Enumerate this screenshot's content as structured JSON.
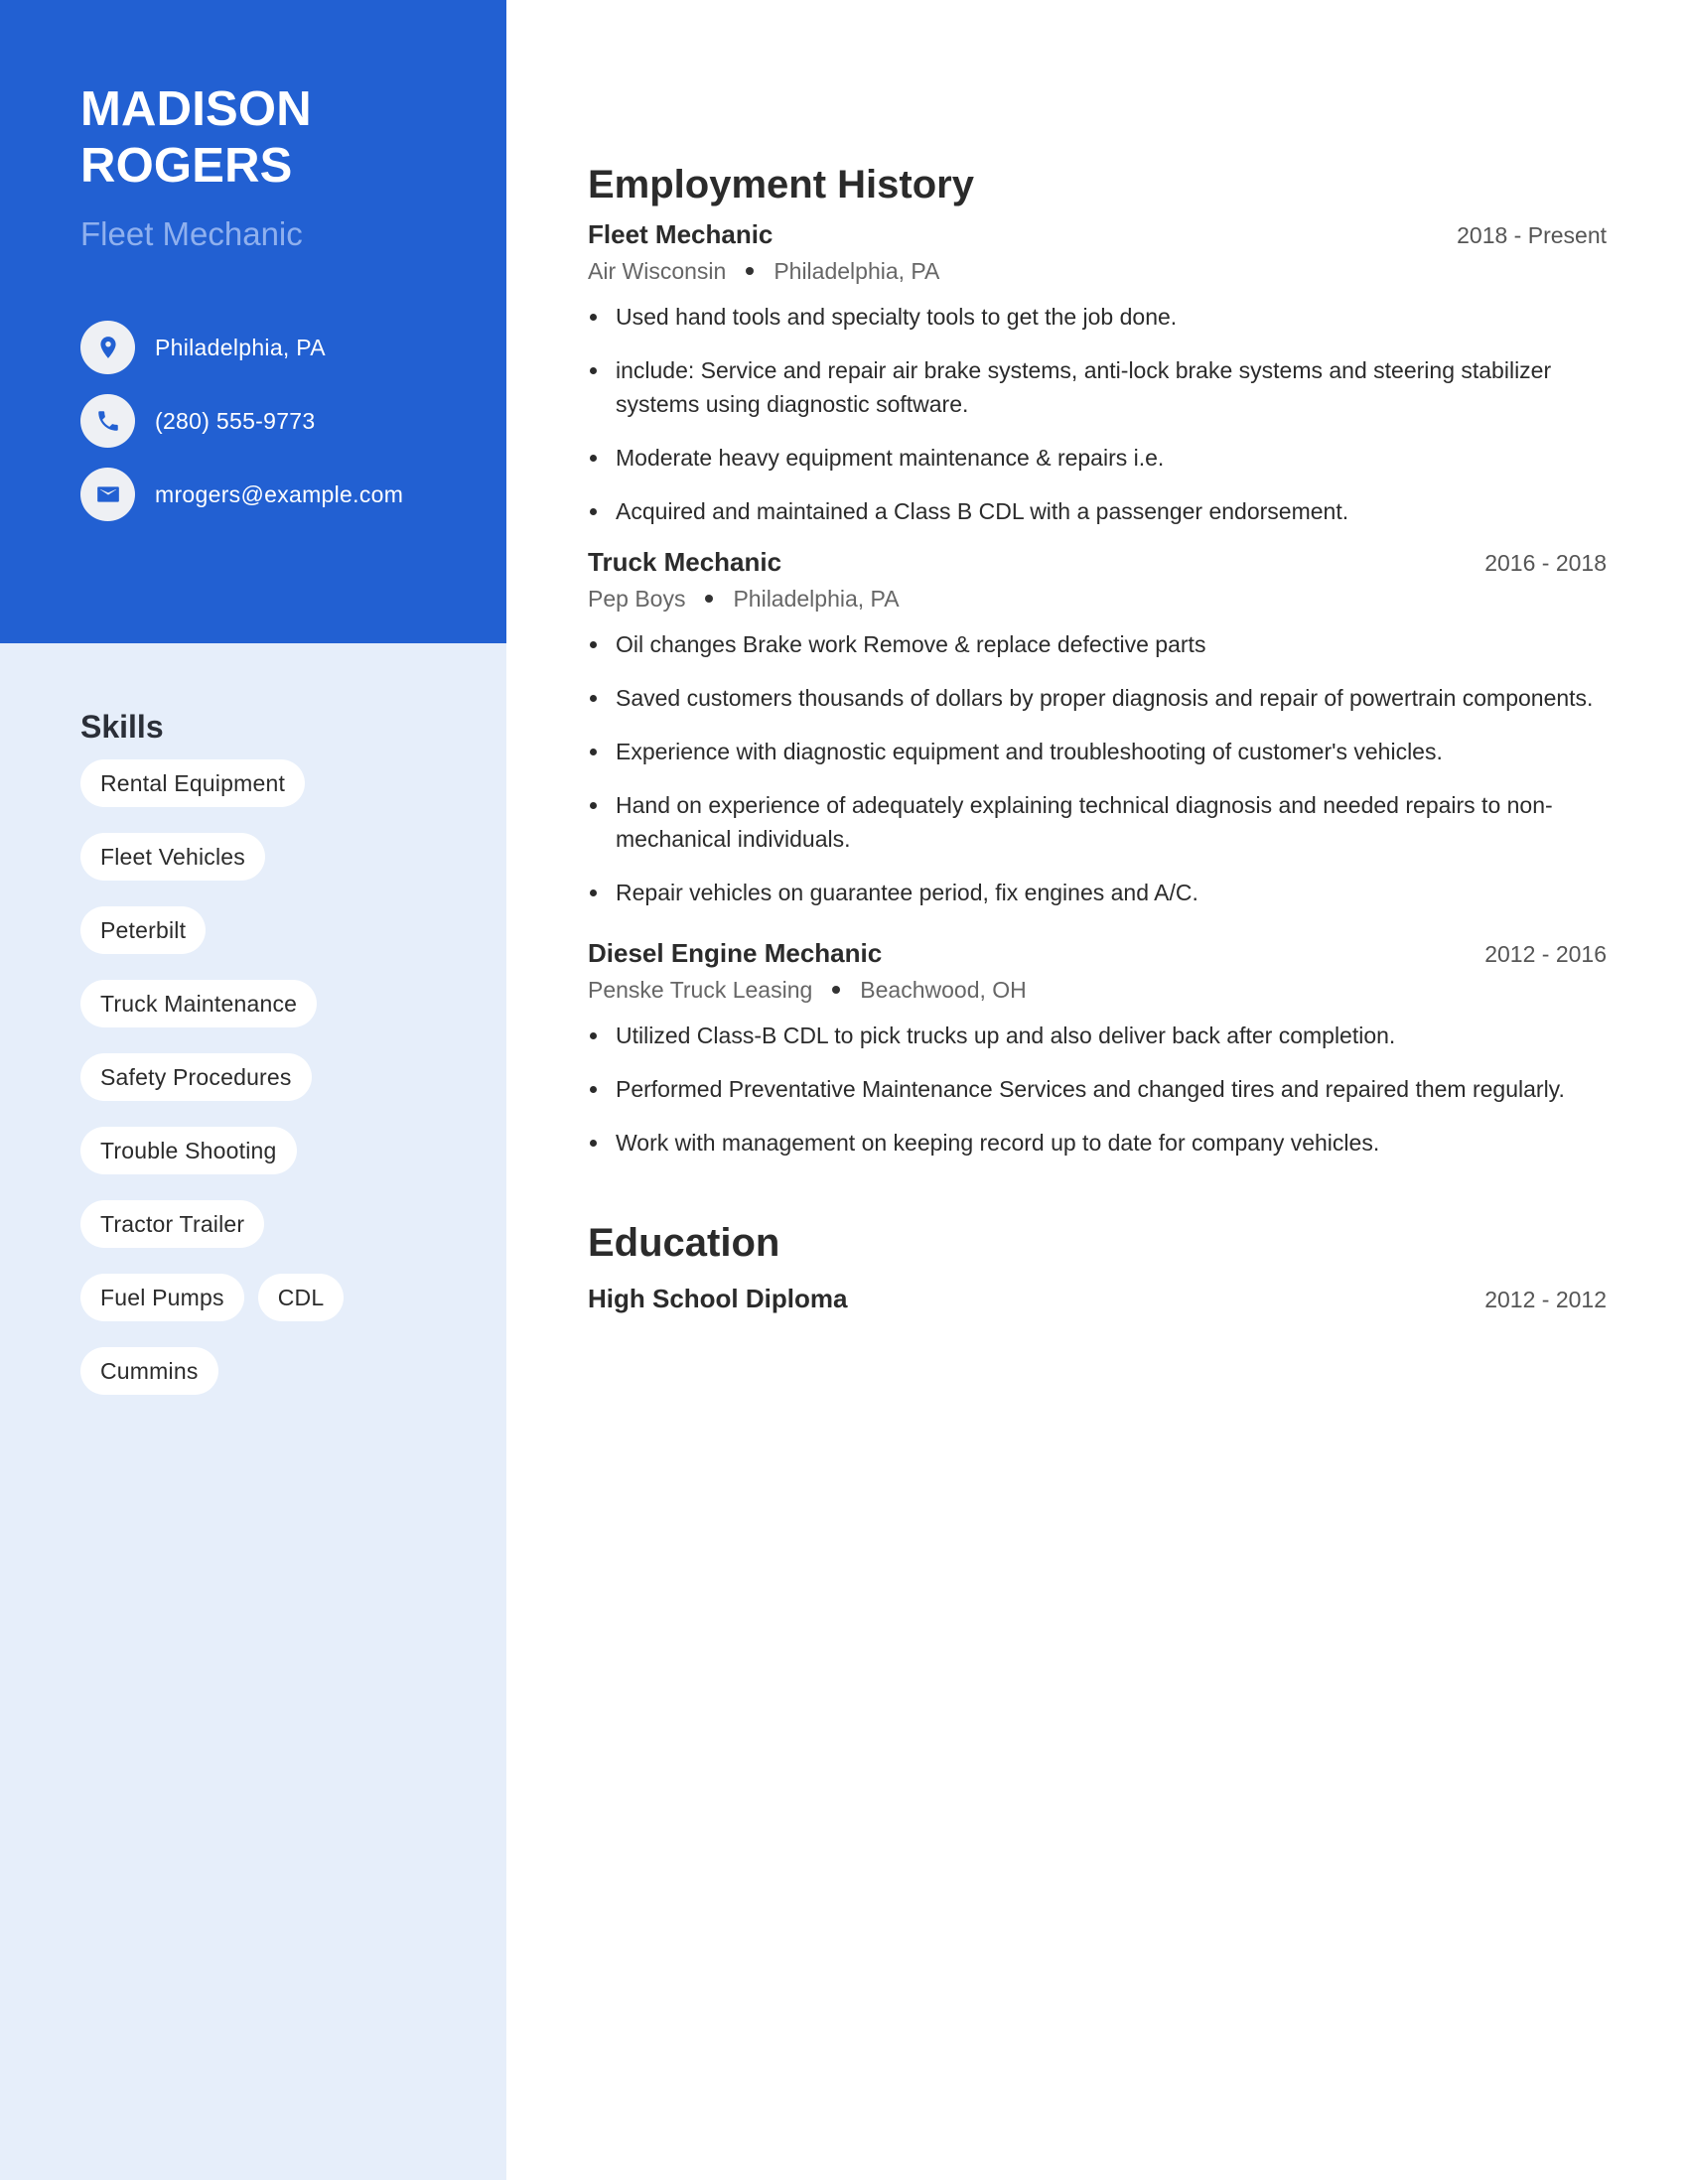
{
  "colors": {
    "accent": "#2260d2",
    "sidebar_bg": "#e6eefa",
    "subtitle": "#8fb0ee",
    "text": "#2b2b2b"
  },
  "profile": {
    "name": "MADISON ROGERS",
    "title": "Fleet Mechanic"
  },
  "contacts": [
    {
      "icon": "location-pin-icon",
      "text": "Philadelphia, PA"
    },
    {
      "icon": "phone-icon",
      "text": "(280) 555-9773"
    },
    {
      "icon": "email-icon",
      "text": "mrogers@example.com"
    }
  ],
  "skills": {
    "heading": "Skills",
    "items": [
      "Rental Equipment",
      "Fleet Vehicles",
      "Peterbilt",
      "Truck Maintenance",
      "Safety Procedures",
      "Trouble Shooting",
      "Tractor Trailer",
      "Fuel Pumps",
      "CDL",
      "Cummins"
    ]
  },
  "employment": {
    "heading": "Employment History",
    "jobs": [
      {
        "title": "Fleet Mechanic",
        "dates": "2018 - Present",
        "company": "Air Wisconsin",
        "location": "Philadelphia, PA",
        "bullets": [
          "Used hand tools and specialty tools to get the job done.",
          "include: Service and repair air brake systems, anti-lock brake systems and steering stabilizer systems using diagnostic software.",
          "Moderate heavy equipment maintenance & repairs i.e.",
          "Acquired and maintained a Class B CDL with a passenger endorsement."
        ]
      },
      {
        "title": "Truck Mechanic",
        "dates": "2016 - 2018",
        "company": "Pep Boys",
        "location": "Philadelphia, PA",
        "bullets": [
          "Oil changes Brake work Remove & replace defective parts",
          "Saved customers thousands of dollars by proper diagnosis and repair of powertrain components.",
          "Experience with diagnostic equipment and troubleshooting of customer's vehicles.",
          "Hand on experience of adequately explaining technical diagnosis and needed repairs to non-mechanical individuals.",
          "Repair vehicles on guarantee period, fix engines and A/C."
        ]
      },
      {
        "title": "Diesel Engine Mechanic",
        "dates": "2012 - 2016",
        "company": "Penske Truck Leasing",
        "location": "Beachwood, OH",
        "bullets": [
          "Utilized Class-B CDL to pick trucks up and also deliver back after completion.",
          "Performed Preventative Maintenance Services and changed tires and repaired them regularly.",
          "Work with management on keeping record up to date for company vehicles."
        ]
      }
    ]
  },
  "education": {
    "heading": "Education",
    "items": [
      {
        "degree": "High School Diploma",
        "dates": "2012 - 2012"
      }
    ]
  }
}
